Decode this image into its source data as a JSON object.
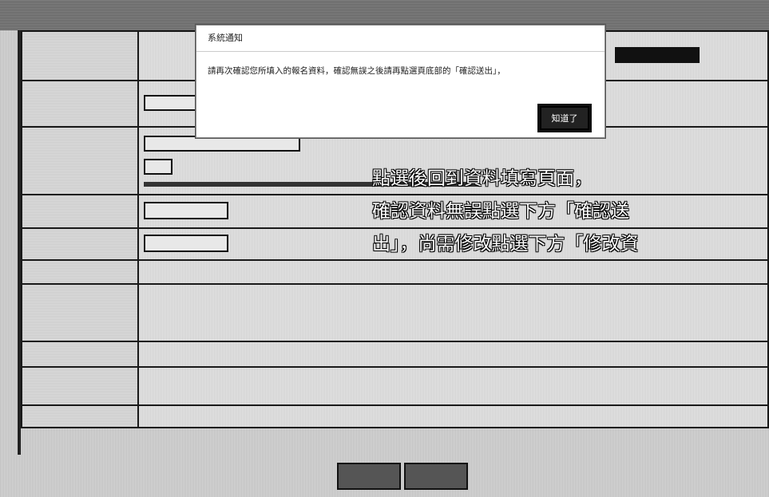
{
  "dialog": {
    "title": "系統通知",
    "message": "請再次確認您所填入的報名資料，確認無誤之後請再點選頁底部的「確認送出」，",
    "ok_label": "知道了"
  },
  "callout": {
    "line1": "點選後回到資料填寫頁面，",
    "line2": "確認資料無誤點選下方「確認送",
    "line3": "出」，尚需修改點選下方「修改資"
  }
}
